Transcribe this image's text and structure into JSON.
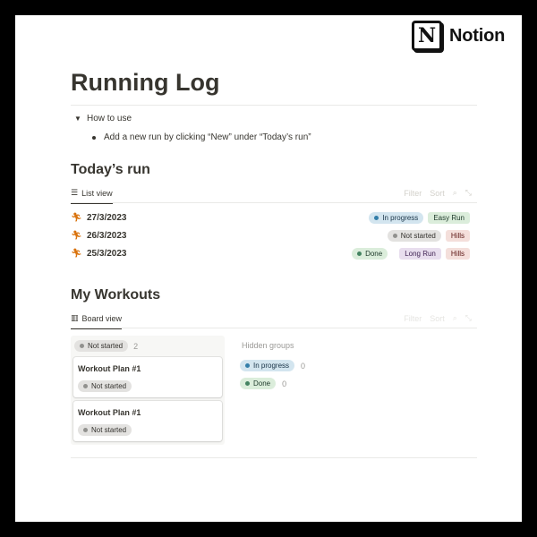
{
  "brand": {
    "logo_letter": "N",
    "name": "Notion"
  },
  "page": {
    "title": "Running Log",
    "toggle": {
      "arrow_icon": "triangle-down-icon",
      "label": "How to use"
    },
    "bullet_text": "Add a new run by clicking “New” under “Today’s run”"
  },
  "todays_run": {
    "title": "Today’s run",
    "view_tab": {
      "icon": "list-icon",
      "label": "List view"
    },
    "tools": {
      "filter": "Filter",
      "sort": "Sort",
      "search_icon": "search-icon",
      "expand_icon": "expand-icon"
    },
    "rows": [
      {
        "icon": "runner-icon",
        "date": "27/3/2023",
        "status": "In progress",
        "tags": [
          "Easy Run"
        ]
      },
      {
        "icon": "runner-icon",
        "date": "26/3/2023",
        "status": "Not started",
        "tags": [
          "Hills"
        ]
      },
      {
        "icon": "runner-icon",
        "date": "25/3/2023",
        "status": "Done",
        "tags": [
          "Long Run",
          "Hills"
        ]
      }
    ]
  },
  "workouts": {
    "title": "My Workouts",
    "view_tab": {
      "icon": "board-icon",
      "label": "Board view"
    },
    "tools": {
      "filter": "Filter",
      "sort": "Sort",
      "search_icon": "search-icon",
      "expand_icon": "expand-icon"
    },
    "column": {
      "status": "Not started",
      "count": "2",
      "cards": [
        {
          "title": "Workout Plan #1",
          "status": "Not started"
        },
        {
          "title": "Workout Plan #1",
          "status": "Not started"
        }
      ]
    },
    "hidden_groups": {
      "label": "Hidden groups",
      "groups": [
        {
          "status": "In progress",
          "count": "0"
        },
        {
          "status": "Done",
          "count": "0"
        }
      ]
    }
  },
  "colors": {
    "in_progress_bg": "#d3e5ef",
    "in_progress_dot": "#337ea9",
    "not_started_bg": "#e3e2e0",
    "not_started_dot": "#91918e",
    "done_bg": "#dbeddb",
    "done_dot": "#448361",
    "easy_run_bg": "#dbeddb",
    "easy_run_fg": "#1c3829",
    "hills_bg": "#f4dfdb",
    "hills_fg": "#5d1715",
    "long_run_bg": "#e8deee",
    "long_run_fg": "#412454",
    "runner_icon": "#d9730d"
  }
}
